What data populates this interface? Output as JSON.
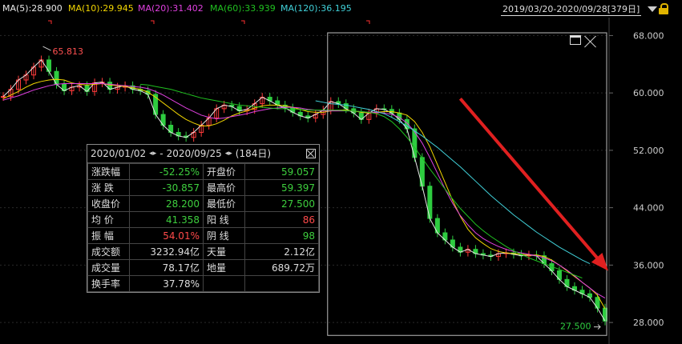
{
  "ma_legend": [
    {
      "label": "MA(5):28.900",
      "color": "#e8e8e8"
    },
    {
      "label": "MA(10):29.945",
      "color": "#f2d600"
    },
    {
      "label": "MA(20):31.402",
      "color": "#e040e0"
    },
    {
      "label": "MA(60):33.939",
      "color": "#20c020"
    },
    {
      "label": "MA(120):36.195",
      "color": "#40d0d8"
    }
  ],
  "date_range": "2019/03/20-2020/09/28[379日]",
  "stats_panel": {
    "start": "2020/01/02",
    "end": "2020/09/25",
    "nav_left": "◂▸",
    "nav_right": "◂▸",
    "separator": "-",
    "days": "(184日)",
    "rows": [
      {
        "l1": "涨跌幅",
        "v1": "-52.25%",
        "c1": "neg",
        "l2": "开盘价",
        "v2": "59.057",
        "c2": "neg"
      },
      {
        "l1": "涨 跌",
        "v1": "-30.857",
        "c1": "neg",
        "l2": "最高价",
        "v2": "59.397",
        "c2": "neg"
      },
      {
        "l1": "收盘价",
        "v1": "28.200",
        "c1": "neg",
        "l2": "最低价",
        "v2": "27.500",
        "c2": "neg"
      },
      {
        "l1": "均 价",
        "v1": "41.358",
        "c1": "neg",
        "l2": "阳 线",
        "v2": "86",
        "c2": "pos"
      },
      {
        "l1": "振 幅",
        "v1": "54.01%",
        "c1": "pos",
        "l2": "阴 线",
        "v2": "98",
        "c2": "neg"
      },
      {
        "l1": "成交额",
        "v1": "3232.94亿",
        "c1": "neu",
        "l2": "天量",
        "v2": "2.12亿",
        "c2": "neu"
      },
      {
        "l1": "成交量",
        "v1": "78.17亿",
        "c1": "neu",
        "l2": "地量",
        "v2": "689.72万",
        "c2": "neu"
      },
      {
        "l1": "换手率",
        "v1": "37.78%",
        "c1": "neu",
        "l2": "",
        "v2": "",
        "c2": "neu"
      }
    ]
  },
  "chart_data": {
    "type": "line",
    "y_ticks": [
      "68.000",
      "60.000",
      "52.000",
      "44.000",
      "36.000",
      "28.000"
    ],
    "ylim": [
      25.0,
      70.5
    ],
    "annotations": {
      "high_label": "65.813",
      "low_label": "27.500"
    },
    "price_series": [
      59.5,
      60.5,
      61.8,
      62.5,
      63.6,
      64.6,
      63.0,
      61.2,
      60.3,
      60.8,
      61.0,
      60.2,
      61.4,
      61.5,
      60.5,
      60.8,
      61.0,
      60.5,
      60.3,
      59.8,
      57.0,
      55.5,
      54.5,
      54.0,
      53.8,
      54.5,
      55.5,
      56.5,
      57.8,
      58.3,
      58.1,
      57.5,
      57.7,
      58.5,
      59.4,
      58.9,
      58.3,
      57.9,
      57.3,
      56.8,
      56.5,
      57.0,
      57.6,
      58.8,
      58.5,
      57.8,
      57.2,
      56.3,
      57.2,
      57.8,
      57.7,
      57.2,
      56.3,
      55.0,
      51.0,
      47.0,
      42.5,
      40.5,
      39.5,
      38.5,
      37.8,
      38.2,
      37.6,
      37.4,
      37.2,
      37.6,
      37.7,
      37.5,
      37.3,
      37.4,
      37.3,
      36.2,
      35.2,
      34.0,
      33.0,
      32.5,
      32.0,
      31.5,
      30.0,
      28.2
    ],
    "moving_averages": [
      {
        "name": "MA(10)",
        "values": [
          59.2,
          59.7,
          60.2,
          60.8,
          61.3,
          61.6,
          61.8,
          61.9,
          61.8,
          61.4,
          61.2,
          61.1,
          61.2,
          61.3,
          61.1,
          61.0,
          60.9,
          60.7,
          60.5,
          60.1,
          59.4,
          58.6,
          57.8,
          57.0,
          56.3,
          55.8,
          55.4,
          55.4,
          55.7,
          56.2,
          56.8,
          57.2,
          57.5,
          57.9,
          58.2,
          58.3,
          58.3,
          58.2,
          58.0,
          57.7,
          57.4,
          57.3,
          57.3,
          57.5,
          57.6,
          57.6,
          57.5,
          57.3,
          57.2,
          57.3,
          57.4,
          57.4,
          57.2,
          56.9,
          56.0,
          54.5,
          52.5,
          50.0,
          47.5,
          45.0,
          42.8,
          41.0,
          39.8,
          39.0,
          38.3,
          37.9,
          37.7,
          37.6,
          37.5,
          37.4,
          37.4,
          37.2,
          36.7,
          36.0,
          35.2,
          34.4,
          33.6,
          32.8,
          31.8,
          29.9
        ]
      },
      {
        "name": "MA(20)",
        "values": [
          59.0,
          59.3,
          59.6,
          60.0,
          60.4,
          60.7,
          61.0,
          61.2,
          61.3,
          61.3,
          61.3,
          61.3,
          61.3,
          61.3,
          61.2,
          61.1,
          61.0,
          60.9,
          60.8,
          60.6,
          60.2,
          59.7,
          59.1,
          58.5,
          57.9,
          57.4,
          56.9,
          56.6,
          56.4,
          56.5,
          56.7,
          56.9,
          57.1,
          57.4,
          57.6,
          57.8,
          57.9,
          58.0,
          58.0,
          57.9,
          57.7,
          57.6,
          57.5,
          57.5,
          57.5,
          57.5,
          57.5,
          57.4,
          57.3,
          57.3,
          57.2,
          57.0,
          56.6,
          55.8,
          54.6,
          53.0,
          51.0,
          48.8,
          46.6,
          44.6,
          42.9,
          41.6,
          40.5,
          39.7,
          39.1,
          38.6,
          38.2,
          37.9,
          37.7,
          37.5,
          37.3,
          37.0,
          36.6,
          36.0,
          35.3,
          34.5,
          33.6,
          32.8,
          32.0,
          31.4
        ]
      },
      {
        "name": "MA(60)",
        "values": [
          null,
          null,
          null,
          null,
          null,
          null,
          null,
          null,
          null,
          null,
          null,
          null,
          null,
          null,
          null,
          null,
          null,
          null,
          61.2,
          61.1,
          60.9,
          60.7,
          60.5,
          60.2,
          59.9,
          59.6,
          59.3,
          59.1,
          58.9,
          58.7,
          58.5,
          58.3,
          58.2,
          58.1,
          58.0,
          57.9,
          57.8,
          57.8,
          57.7,
          57.7,
          57.6,
          57.6,
          57.6,
          57.6,
          57.6,
          57.5,
          57.5,
          57.4,
          57.3,
          57.1,
          56.7,
          56.0,
          55.0,
          53.8,
          52.4,
          50.9,
          49.4,
          48.0,
          46.6,
          45.2,
          43.9,
          42.8,
          41.7,
          40.8,
          40.0,
          39.3,
          38.6,
          38.0,
          37.5,
          37.0,
          36.6,
          36.2,
          35.8,
          35.4,
          35.0,
          34.6,
          34.2
        ]
      },
      {
        "name": "MA(120)",
        "values": [
          null,
          null,
          null,
          null,
          null,
          null,
          null,
          null,
          null,
          null,
          null,
          null,
          null,
          null,
          null,
          null,
          null,
          null,
          null,
          null,
          null,
          null,
          null,
          null,
          null,
          null,
          null,
          null,
          null,
          null,
          null,
          null,
          null,
          null,
          null,
          null,
          null,
          null,
          null,
          null,
          null,
          58.9,
          58.7,
          58.5,
          58.4,
          58.3,
          58.1,
          57.9,
          57.7,
          57.4,
          57.1,
          56.6,
          56.0,
          55.4,
          54.7,
          54.0,
          53.2,
          52.4,
          51.5,
          50.6,
          49.7,
          48.7,
          47.7,
          46.7,
          45.7,
          44.8,
          43.9,
          43.0,
          42.2,
          41.4,
          40.6,
          39.9,
          39.2,
          38.5,
          37.9,
          37.3,
          36.7,
          36.2
        ]
      }
    ],
    "annotation_colors": {
      "high": "#ff5050",
      "low": "#2ecc40",
      "arrow": "#e02020",
      "axis_text": "#cccccc"
    },
    "selection_box": {
      "from_index": 43,
      "to_index": 79
    }
  }
}
